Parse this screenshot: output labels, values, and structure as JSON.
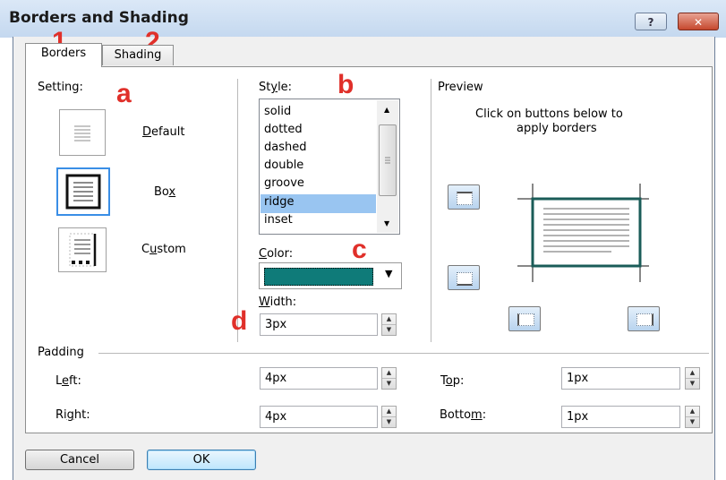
{
  "window": {
    "title": "Borders and Shading",
    "help_label": "?",
    "close_label": "✕"
  },
  "tabs": [
    {
      "label": "Borders"
    },
    {
      "label": "Shading"
    }
  ],
  "annotations": {
    "n1": "1",
    "n2": "2",
    "a": "a",
    "b": "b",
    "c": "c",
    "d": "d"
  },
  "setting": {
    "label": "Setting:",
    "options": [
      {
        "label": "Default",
        "icon": "default-border-icon",
        "selected": false
      },
      {
        "label": "Box",
        "icon": "box-border-icon",
        "selected": true
      },
      {
        "label": "Custom",
        "icon": "custom-border-icon",
        "selected": false
      }
    ]
  },
  "style": {
    "label": "Style:",
    "items": [
      "solid",
      "dotted",
      "dashed",
      "double",
      "groove",
      "ridge",
      "inset"
    ],
    "selected": "ridge"
  },
  "color": {
    "label": "Color:",
    "value": "#0f7b79"
  },
  "width": {
    "label": "Width:",
    "value": "3px"
  },
  "preview": {
    "label": "Preview",
    "hint_line1": "Click on buttons below to",
    "hint_line2": "apply borders",
    "border_color": "#1a5c58"
  },
  "padding": {
    "label": "Padding",
    "left": {
      "label": "Left:",
      "value": "4px"
    },
    "right": {
      "label": "Right:",
      "value": "4px"
    },
    "top": {
      "label": "Top:",
      "value": "1px"
    },
    "bottom": {
      "label": "Bottom:",
      "value": "1px"
    }
  },
  "buttons": {
    "cancel": "Cancel",
    "ok": "OK"
  }
}
